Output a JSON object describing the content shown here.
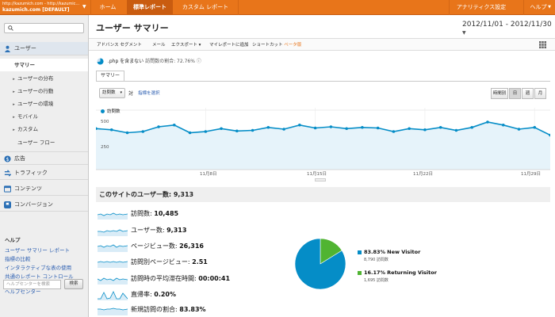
{
  "account": {
    "line1": "http://kazumich.com - http://kazumic...",
    "line2": "kazumich.com [DEFAULT]",
    "dropdown": "▼"
  },
  "topnav": {
    "home": "ホーム",
    "standard": "標準レポート",
    "custom": "カスタム レポート",
    "settings": "アナリティクス設定",
    "help": "ヘルプ",
    "help_arrow": "▼"
  },
  "sidebar": {
    "search_placeholder": "",
    "users": "ユーザー",
    "summary": "サマリー",
    "items": [
      "ユーザーの分布",
      "ユーザーの行動",
      "ユーザーの環境",
      "モバイル",
      "カスタム"
    ],
    "flow": "ユーザー フロー",
    "ads": "広告",
    "traffic": "トラフィック",
    "content": "コンテンツ",
    "conversion": "コンバージョン",
    "help_title": "ヘルプ",
    "help_links": [
      "ユーザー サマリー レポート",
      "指標の比較",
      "インタラクティブな表の使用",
      "共通のレポート コントロール"
    ],
    "help_center": "ヘルプセンター",
    "help_search_placeholder": "ヘルプセンターを検索",
    "help_search_button": "検索"
  },
  "header": {
    "title": "ユーザー サマリー",
    "date_range": "2012/11/01 - 2012/11/30",
    "date_arrow": "▼"
  },
  "toolbar": {
    "advanced_segment": "アドバンス セグメント",
    "email": "メール",
    "export": "エクスポート ▾",
    "add_dashboard": "マイレポートに追加",
    "shortcut": "ショートカット",
    "beta": "ベータ版"
  },
  "segment": {
    "name": ".php を含まない",
    "label": "訪問数の割合: 72.76%",
    "info": "ⓘ"
  },
  "tab": {
    "summary": "サマリー"
  },
  "chart_controls": {
    "metric": "訪問数",
    "vs": "対",
    "pick_metric": "指標を選択",
    "granularity": [
      "時間別",
      "日",
      "週",
      "月"
    ],
    "active": "日"
  },
  "chart_data": {
    "type": "area",
    "title": "",
    "series": [
      {
        "name": "訪問数",
        "values": [
          345,
          335,
          310,
          320,
          360,
          375,
          310,
          320,
          345,
          325,
          330,
          355,
          340,
          375,
          350,
          360,
          345,
          355,
          350,
          320,
          345,
          335,
          355,
          330,
          355,
          400,
          375,
          340,
          355,
          290
        ]
      }
    ],
    "x": [
      "11/1",
      "11/2",
      "11/3",
      "11/4",
      "11/5",
      "11/6",
      "11/7",
      "11/8",
      "11/9",
      "11/10",
      "11/11",
      "11/12",
      "11/13",
      "11/14",
      "11/15",
      "11/16",
      "11/17",
      "11/18",
      "11/19",
      "11/20",
      "11/21",
      "11/22",
      "11/23",
      "11/24",
      "11/25",
      "11/26",
      "11/27",
      "11/28",
      "11/29",
      "11/30"
    ],
    "y_ticks": [
      "500",
      "250"
    ],
    "x_ticks": [
      "11月8日",
      "11月15日",
      "11月22日",
      "11月29日"
    ],
    "ylim": [
      0,
      520
    ],
    "color": "#058dc7",
    "fill": "#e6f3fa"
  },
  "overview": {
    "title": "このサイトのユーザー数: 9,313",
    "stats": [
      {
        "label": "訪問数",
        "value": "10,485"
      },
      {
        "label": "ユーザー数",
        "value": "9,313"
      },
      {
        "label": "ページビュー数",
        "value": "26,316"
      },
      {
        "label": "訪問別ページビュー",
        "value": "2.51"
      },
      {
        "label": "訪問時の平均滞在時間",
        "value": "00:00:41"
      },
      {
        "label": "直帰率",
        "value": "0.20%"
      },
      {
        "label": "新規訪問の割合",
        "value": "83.83%"
      }
    ]
  },
  "visitor_pie": {
    "new": {
      "pct": "83.83%",
      "label": "New Visitor",
      "visits": "8,790 訪問数",
      "color": "#058dc7",
      "share": 0.8383
    },
    "returning": {
      "pct": "16.17%",
      "label": "Returning Visitor",
      "visits": "1,695 訪問数",
      "color": "#50b432",
      "share": 0.1617
    }
  }
}
